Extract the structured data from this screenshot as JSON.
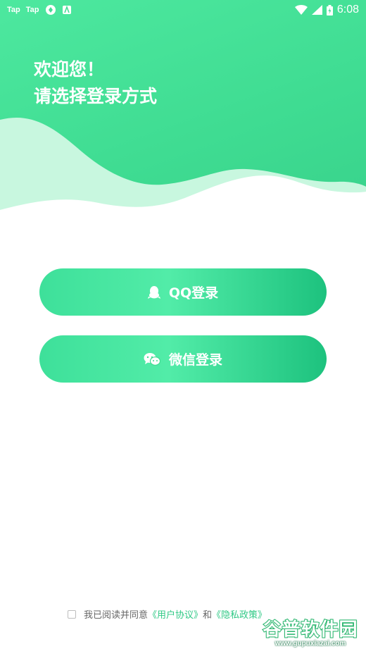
{
  "status_bar": {
    "left_items": [
      "Tap",
      "Tap"
    ],
    "time": "6:08",
    "icons": [
      "wifi-icon",
      "signal-icon",
      "battery-icon"
    ]
  },
  "header": {
    "greeting_line1": "欢迎您！",
    "greeting_line2": "请选择登录方式"
  },
  "buttons": {
    "qq_label": "QQ登录",
    "wechat_label": "微信登录"
  },
  "agreement": {
    "prefix": "我已阅读并同意",
    "user_agreement": "《用户协议》",
    "conjunction": "和",
    "privacy_policy": "《隐私政策》"
  },
  "watermark": {
    "title": "谷普软件园",
    "url": "www.gupuxiazai.com"
  },
  "colors": {
    "accent": "#3ee09a",
    "accent_dark": "#1dc27e",
    "link": "#2fc985"
  }
}
